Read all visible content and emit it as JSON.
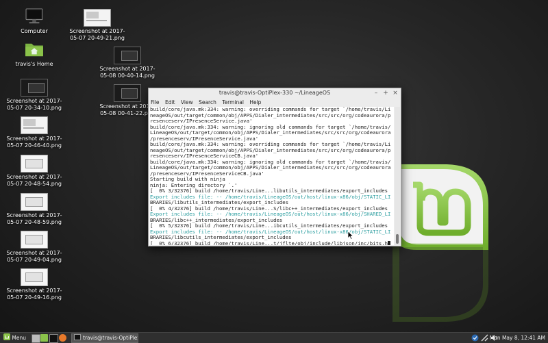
{
  "desktop": {
    "icons": [
      {
        "label": "Computer"
      },
      {
        "label": "travis's Home"
      },
      {
        "label": "Screenshot at 2017-05-07 20-34-10.png"
      },
      {
        "label": "Screenshot at 2017-05-07 20-46-40.png"
      },
      {
        "label": "Screenshot at 2017-05-07 20-48-54.png"
      },
      {
        "label": "Screenshot at 2017-05-07 20-48-59.png"
      },
      {
        "label": "Screenshot at 2017-05-07 20-49-04.png"
      },
      {
        "label": "Screenshot at 2017-05-07 20-49-16.png"
      },
      {
        "label": "Screenshot at 2017-05-07 20-49-21.png"
      },
      {
        "label": "Screenshot at 2017-05-08 00-40-14.png"
      },
      {
        "label": "Screenshot at 2017-05-08 00-41-22.png"
      }
    ]
  },
  "terminal": {
    "title": "travis@travis-OptiPlex-330 ~/LineageOS",
    "menu": [
      "File",
      "Edit",
      "View",
      "Search",
      "Terminal",
      "Help"
    ],
    "lines": [
      {
        "text": "build/core/java.mk:334: warning: overriding commands for target `/home/travis/Li",
        "cls": ""
      },
      {
        "text": "neageOS/out/target/common/obj/APPS/Dialer_intermediates/src/src/org/codeaurora/p",
        "cls": ""
      },
      {
        "text": "resenceserv/IPresenceService.java'",
        "cls": ""
      },
      {
        "text": "build/core/java.mk:334: warning: ignoring old commands for target `/home/travis/",
        "cls": ""
      },
      {
        "text": "LineageOS/out/target/common/obj/APPS/Dialer_intermediates/src/src/org/codeaurora",
        "cls": ""
      },
      {
        "text": "/presenceserv/IPresenceService.java'",
        "cls": ""
      },
      {
        "text": "build/core/java.mk:334: warning: overriding commands for target `/home/travis/Li",
        "cls": ""
      },
      {
        "text": "neageOS/out/target/common/obj/APPS/Dialer_intermediates/src/src/org/codeaurora/p",
        "cls": ""
      },
      {
        "text": "resenceserv/IPresenceServiceCB.java'",
        "cls": ""
      },
      {
        "text": "build/core/java.mk:334: warning: ignoring old commands for target `/home/travis/",
        "cls": ""
      },
      {
        "text": "LineageOS/out/target/common/obj/APPS/Dialer_intermediates/src/src/org/codeaurora",
        "cls": ""
      },
      {
        "text": "/presenceserv/IPresenceServiceCB.java'",
        "cls": ""
      },
      {
        "text": "Starting build with ninja",
        "cls": ""
      },
      {
        "text": "ninja: Entering directory `.'",
        "cls": ""
      },
      {
        "text": "[  0% 3/32376] build /home/travis/Line...libutils_intermediates/export_includes",
        "cls": ""
      },
      {
        "text": "Export includes file: -- /home/travis/LineageOS/out/host/linux-x86/obj/STATIC_LI",
        "cls": "cyan"
      },
      {
        "text": "BRARIES/libutils_intermediates/export_includes",
        "cls": ""
      },
      {
        "text": "[  0% 4/32376] build /home/travis/Line...S/libc++_intermediates/export_includes",
        "cls": ""
      },
      {
        "text": "Export includes file: -- /home/travis/LineageOS/out/host/linux-x86/obj/SHARED_LI",
        "cls": "cyan"
      },
      {
        "text": "BRARIES/libc++_intermediates/export_includes",
        "cls": ""
      },
      {
        "text": "[  0% 5/32376] build /home/travis/Line...ibcutils_intermediates/export_includes",
        "cls": ""
      },
      {
        "text": "Export includes file: -- /home/travis/LineageOS/out/host/linux-x86/obj/STATIC_LI",
        "cls": "cyan"
      },
      {
        "text": "BRARIES/libcutils_intermediates/export_includes",
        "cls": ""
      },
      {
        "text": "[  0% 6/32376] build /home/travis/Line...t/jflte/obj/include/libjson/inc/bits.h",
        "cls": ""
      }
    ]
  },
  "taskbar": {
    "menu_label": "Menu",
    "task_label": "travis@travis-OptiPlex...",
    "clock": "Mon May  8, 12:41 AM"
  },
  "colors": {
    "mint_green": "#8bc34a",
    "terminal_cyan": "#2a9d9f"
  }
}
